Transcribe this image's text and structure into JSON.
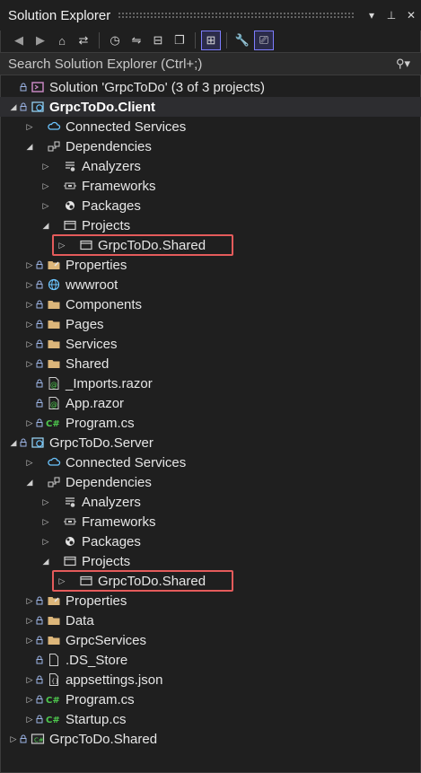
{
  "window": {
    "title": "Solution Explorer"
  },
  "titlebar_buttons": [
    {
      "icon": "dropdown-icon",
      "glyph": "▾"
    },
    {
      "icon": "pin-icon",
      "glyph": "⊥"
    },
    {
      "icon": "close-icon",
      "glyph": "✕"
    }
  ],
  "search": {
    "placeholder": "Search Solution Explorer (Ctrl+;)"
  },
  "colors": {
    "highlight": "#e45b5b",
    "accent": "#7d7dff",
    "folder": "#dcb67a",
    "csharp": "#4ec94e",
    "cloud": "#6cc5ff"
  },
  "tree": [
    {
      "label": "Solution 'GrpcToDo' (3 of 3 projects)",
      "level": 0,
      "exp": "",
      "icon": "solution-icon",
      "lock": true
    },
    {
      "label": "GrpcToDo.Client",
      "level": 0,
      "exp": "open",
      "icon": "blazor-project-icon",
      "lock": true,
      "bold": true,
      "selected": true
    },
    {
      "label": "Connected Services",
      "level": 1,
      "exp": "closed",
      "icon": "cloud-icon",
      "lock": false
    },
    {
      "label": "Dependencies",
      "level": 1,
      "exp": "open",
      "icon": "dependencies-icon",
      "lock": false
    },
    {
      "label": "Analyzers",
      "level": 2,
      "exp": "closed",
      "icon": "analyzer-icon",
      "lock": false
    },
    {
      "label": "Frameworks",
      "level": 2,
      "exp": "closed",
      "icon": "framework-icon",
      "lock": false
    },
    {
      "label": "Packages",
      "level": 2,
      "exp": "closed",
      "icon": "package-icon",
      "lock": false
    },
    {
      "label": "Projects",
      "level": 2,
      "exp": "open",
      "icon": "projects-icon",
      "lock": false
    },
    {
      "label": "GrpcToDo.Shared",
      "level": 3,
      "exp": "closed",
      "icon": "project-ref-icon",
      "lock": false,
      "highlight": true
    },
    {
      "label": "Properties",
      "level": 1,
      "exp": "closed",
      "icon": "properties-folder-icon",
      "lock": true
    },
    {
      "label": "wwwroot",
      "level": 1,
      "exp": "closed",
      "icon": "globe-icon",
      "lock": true
    },
    {
      "label": "Components",
      "level": 1,
      "exp": "closed",
      "icon": "folder-icon",
      "lock": true
    },
    {
      "label": "Pages",
      "level": 1,
      "exp": "closed",
      "icon": "folder-icon",
      "lock": true
    },
    {
      "label": "Services",
      "level": 1,
      "exp": "closed",
      "icon": "folder-icon",
      "lock": true
    },
    {
      "label": "Shared",
      "level": 1,
      "exp": "closed",
      "icon": "folder-icon",
      "lock": true
    },
    {
      "label": "_Imports.razor",
      "level": 1,
      "exp": "",
      "icon": "razor-file-icon",
      "lock": true
    },
    {
      "label": "App.razor",
      "level": 1,
      "exp": "",
      "icon": "razor-file-icon",
      "lock": true
    },
    {
      "label": "Program.cs",
      "level": 1,
      "exp": "closed",
      "icon": "csharp-file-icon",
      "lock": true
    },
    {
      "label": "GrpcToDo.Server",
      "level": 0,
      "exp": "open",
      "icon": "web-project-icon",
      "lock": true
    },
    {
      "label": "Connected Services",
      "level": 1,
      "exp": "closed",
      "icon": "cloud-icon",
      "lock": false
    },
    {
      "label": "Dependencies",
      "level": 1,
      "exp": "open",
      "icon": "dependencies-icon",
      "lock": false
    },
    {
      "label": "Analyzers",
      "level": 2,
      "exp": "closed",
      "icon": "analyzer-icon",
      "lock": false
    },
    {
      "label": "Frameworks",
      "level": 2,
      "exp": "closed",
      "icon": "framework-icon",
      "lock": false
    },
    {
      "label": "Packages",
      "level": 2,
      "exp": "closed",
      "icon": "package-icon",
      "lock": false
    },
    {
      "label": "Projects",
      "level": 2,
      "exp": "open",
      "icon": "projects-icon",
      "lock": false
    },
    {
      "label": "GrpcToDo.Shared",
      "level": 3,
      "exp": "closed",
      "icon": "project-ref-icon",
      "lock": false,
      "highlight": true
    },
    {
      "label": "Properties",
      "level": 1,
      "exp": "closed",
      "icon": "properties-folder-icon",
      "lock": true
    },
    {
      "label": "Data",
      "level": 1,
      "exp": "closed",
      "icon": "folder-icon",
      "lock": true
    },
    {
      "label": "GrpcServices",
      "level": 1,
      "exp": "closed",
      "icon": "folder-icon",
      "lock": true
    },
    {
      "label": ".DS_Store",
      "level": 1,
      "exp": "",
      "icon": "file-icon",
      "lock": true
    },
    {
      "label": "appsettings.json",
      "level": 1,
      "exp": "closed",
      "icon": "json-file-icon",
      "lock": true
    },
    {
      "label": "Program.cs",
      "level": 1,
      "exp": "closed",
      "icon": "csharp-file-icon",
      "lock": true
    },
    {
      "label": "Startup.cs",
      "level": 1,
      "exp": "closed",
      "icon": "csharp-file-icon",
      "lock": true
    },
    {
      "label": "GrpcToDo.Shared",
      "level": 0,
      "exp": "closed",
      "icon": "csharp-project-icon",
      "lock": true
    }
  ]
}
